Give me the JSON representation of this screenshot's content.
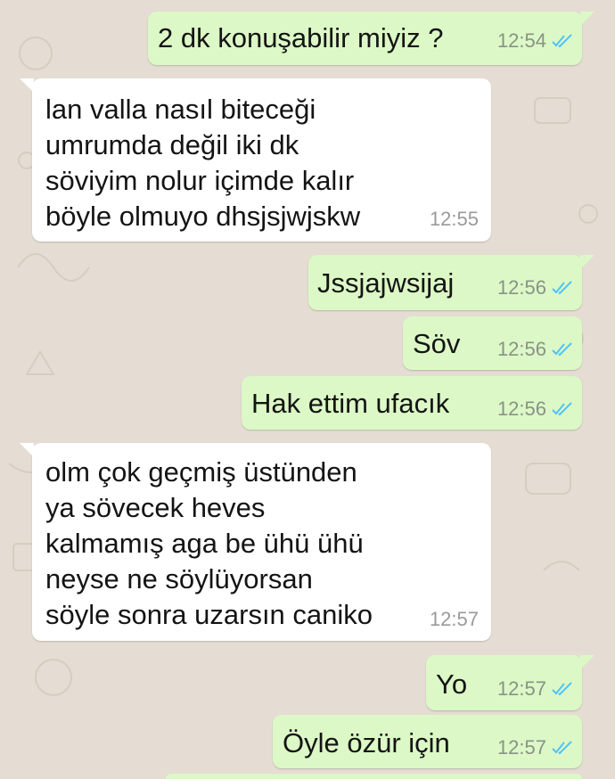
{
  "chat": {
    "messages": [
      {
        "direction": "outgoing",
        "text": "2 dk konuşabilir miyiz ?",
        "time": "12:54",
        "status": "read-double-check-icon"
      },
      {
        "direction": "incoming",
        "text": "lan valla nasıl biteceği\numrumda değil iki dk\nsöviyim nolur içimde kalır\nböyle olmuyo dhsjsjwjskw",
        "time": "12:55"
      },
      {
        "direction": "outgoing",
        "text": "Jssjajwsijaj",
        "time": "12:56",
        "status": "read-double-check-icon"
      },
      {
        "direction": "outgoing",
        "text": "Söv",
        "time": "12:56",
        "status": "read-double-check-icon"
      },
      {
        "direction": "outgoing",
        "text": "Hak ettim ufacık",
        "time": "12:56",
        "status": "read-double-check-icon"
      },
      {
        "direction": "incoming",
        "text": "olm çok geçmiş üstünden\nya sövecek heves\nkalmamış aga be ühü ühü\nneyse ne söylüyorsan\nsöyle sonra uzarsın caniko",
        "time": "12:57"
      },
      {
        "direction": "outgoing",
        "text": "Yo",
        "time": "12:57",
        "status": "read-double-check-icon"
      },
      {
        "direction": "outgoing",
        "text": "Öyle özür için",
        "time": "12:57",
        "status": "read-double-check-icon"
      }
    ]
  },
  "colors": {
    "outgoing_bubble": "#dcf8c6",
    "incoming_bubble": "#ffffff",
    "background": "#e5ddd3",
    "read_tick": "#4fc3f7"
  }
}
